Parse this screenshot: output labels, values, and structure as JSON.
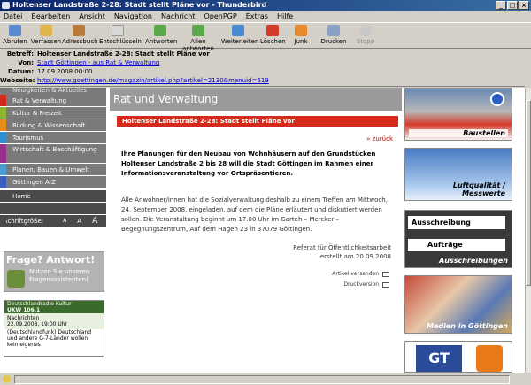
{
  "window": {
    "title": "Holtenser Landstraße 2-28: Stadt stellt Pläne vor - Thunderbird"
  },
  "menu": [
    "Datei",
    "Bearbeiten",
    "Ansicht",
    "Navigation",
    "Nachricht",
    "OpenPGP",
    "Extras",
    "Hilfe"
  ],
  "toolbar": {
    "abrufen": "Abrufen",
    "verfassen": "Verfassen",
    "adressbuch": "Adressbuch",
    "entschluesseln": "Entschlüsseln",
    "antworten": "Antworten",
    "allen_antworten": "Allen antworten",
    "weiterleiten": "Weiterleiten",
    "loeschen": "Löschen",
    "junk": "Junk",
    "drucken": "Drucken",
    "stopp": "Stopp"
  },
  "header": {
    "betreff_label": "Betreff:",
    "betreff": "Holtenser Landstraße 2-28: Stadt stellt Pläne vor",
    "von_label": "Von:",
    "von": "Stadt Göttingen - aus Rat & Verwaltung",
    "datum_label": "Datum:",
    "datum": "17.09.2008 00:00",
    "webseite_label": "Webseite:",
    "webseite": "http://www.goettingen.de/magazin/artikel.php?artikel=2130&menuid=619"
  },
  "nav": {
    "top_partial": "Neuigkeiten & Aktuelles",
    "items": [
      {
        "label": "Rat & Verwaltung",
        "color": "#d42a1b"
      },
      {
        "label": "Kultur & Freizeit",
        "color": "#8ab52f"
      },
      {
        "label": "Bildung & Wissenschaft",
        "color": "#e88a1a"
      },
      {
        "label": "Tourismus",
        "color": "#2a8fd4"
      },
      {
        "label": "Wirtschaft & Beschäftigung",
        "color": "#9a2f8f"
      },
      {
        "label": "Planen, Bauen & Umwelt",
        "color": "#4aa0d4"
      },
      {
        "label": "Göttingen A-Z",
        "color": "#3a5fc4"
      }
    ],
    "home": "Home",
    "schriftgroesse": "Schriftgröße:",
    "font_a": "A"
  },
  "frage": {
    "title": "Frage? Antwort!",
    "line1": "Nutzen Sie unseren",
    "line2": "Fragenassistenten!"
  },
  "radio": {
    "station": "Deutschlandradio Kultur",
    "freq": "UKW 106.1",
    "nachrichten": "Nachrichten",
    "zeit": "22.09.2008, 19:00 Uhr",
    "text1": "(Deutschlandfunk) Deutschland",
    "text2": "und andere G-7-Länder wollen",
    "text3": "kein eigenes"
  },
  "main": {
    "band_title": "Rat und Verwaltung",
    "headline": "Holtenser Landstraße 2-28: Stadt stellt Pläne vor",
    "zurueck": "» zurück",
    "lead": "Ihre Planungen für den Neubau von Wohnhäusern auf den Grundstücken Holtenser Landstraße 2 bis 28 will die Stadt Göttingen im Rahmen einer Informationsveranstaltung vor Ortspräsentieren.",
    "body": "Alle Anwohner/innen hat die Sozialverwaltung deshalb zu einem Treffen am Mittwoch, 24. September 2008, eingeladen, auf dem die Pläne erläutert und diskutiert werden sollen. Die Veranstaltung beginnt um 17.00 Uhr im Garteh – Mercker – Begegnungszentrum, Auf dem Hagen 23 in 37079 Göttingen.",
    "referat": "Referat für Öffentlichkeitsarbeit",
    "erstellt": "erstellt am 20.09.2008",
    "artikel_versenden": "Artikel versenden",
    "druckversion": "Druckversion"
  },
  "right": {
    "baustellen": "Baustellen",
    "luft": "Luftqualität / Messwerte",
    "ausschreibung": "Ausschreibung",
    "auftraege": "Aufträge",
    "ausschreibungen": "Ausschreibungen",
    "medien": "Medien in Göttingen",
    "gt": "GT"
  }
}
